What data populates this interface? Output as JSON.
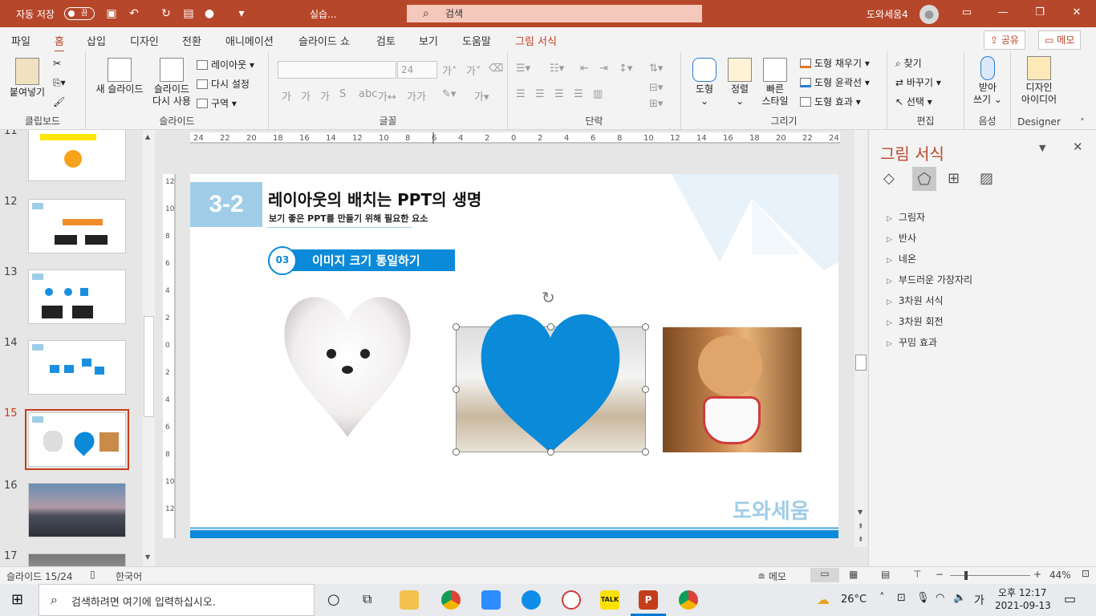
{
  "titlebar": {
    "autosave_label": "자동 저장",
    "autosave_state": "끔",
    "filename": "실습...",
    "search_placeholder": "검색",
    "user": "도와세움4"
  },
  "menu": {
    "tabs": [
      "파일",
      "홈",
      "삽입",
      "디자인",
      "전환",
      "애니메이션",
      "슬라이드 쇼",
      "검토",
      "보기",
      "도움말",
      "그림 서식"
    ],
    "active": "홈",
    "share": "공유",
    "comment": "메모"
  },
  "ribbon": {
    "clipboard": {
      "paste": "붙여넣기",
      "label": "클립보드"
    },
    "slides": {
      "new_slide": "새 슬라이드",
      "reuse_1": "슬라이드",
      "reuse_2": "다시 사용",
      "layout": "레이아웃",
      "reset": "다시 설정",
      "section": "구역",
      "label": "슬라이드"
    },
    "font": {
      "size": "24",
      "label": "글꼴"
    },
    "paragraph": {
      "label": "단락"
    },
    "drawing": {
      "shape": "도형",
      "arrange": "정렬",
      "quick_1": "빠른",
      "quick_2": "스타일",
      "fill": "도형 채우기",
      "outline": "도형 윤곽선",
      "effect": "도형 효과",
      "label": "그리기"
    },
    "editing": {
      "find": "찾기",
      "replace": "바꾸기",
      "select": "선택",
      "label": "편집"
    },
    "voice": {
      "dictate_1": "받아",
      "dictate_2": "쓰기",
      "label": "음성"
    },
    "designer": {
      "ideas_1": "디자인",
      "ideas_2": "아이디어",
      "label": "Designer"
    }
  },
  "thumbnails": [
    "11",
    "12",
    "13",
    "14",
    "15",
    "16",
    "17"
  ],
  "selected_slide": "15",
  "slide": {
    "badge": "3-2",
    "title": "레이아웃의 배치는 PPT의 생명",
    "subtitle": "보기 좋은 PPT를 만들기 위해 필요한 요소",
    "step_num": "03",
    "step_title": "이미지 크기 통일하기",
    "logo": "도와세움"
  },
  "pane": {
    "title": "그림 서식",
    "items": [
      "그림자",
      "반사",
      "네온",
      "부드러운 가장자리",
      "3차원 서식",
      "3차원 회전",
      "꾸밈 효과"
    ]
  },
  "status": {
    "slide_info": "슬라이드 15/24",
    "language": "한국어",
    "notes": "메모",
    "zoom": "44%"
  },
  "taskbar": {
    "search_placeholder": "검색하려면 여기에 입력하십시오.",
    "weather": "26°C",
    "ime": "가",
    "time": "오후 12:17",
    "date": "2021-09-13"
  },
  "colors": {
    "accent": "#b7472a",
    "slide_blue": "#0a8ad8"
  }
}
